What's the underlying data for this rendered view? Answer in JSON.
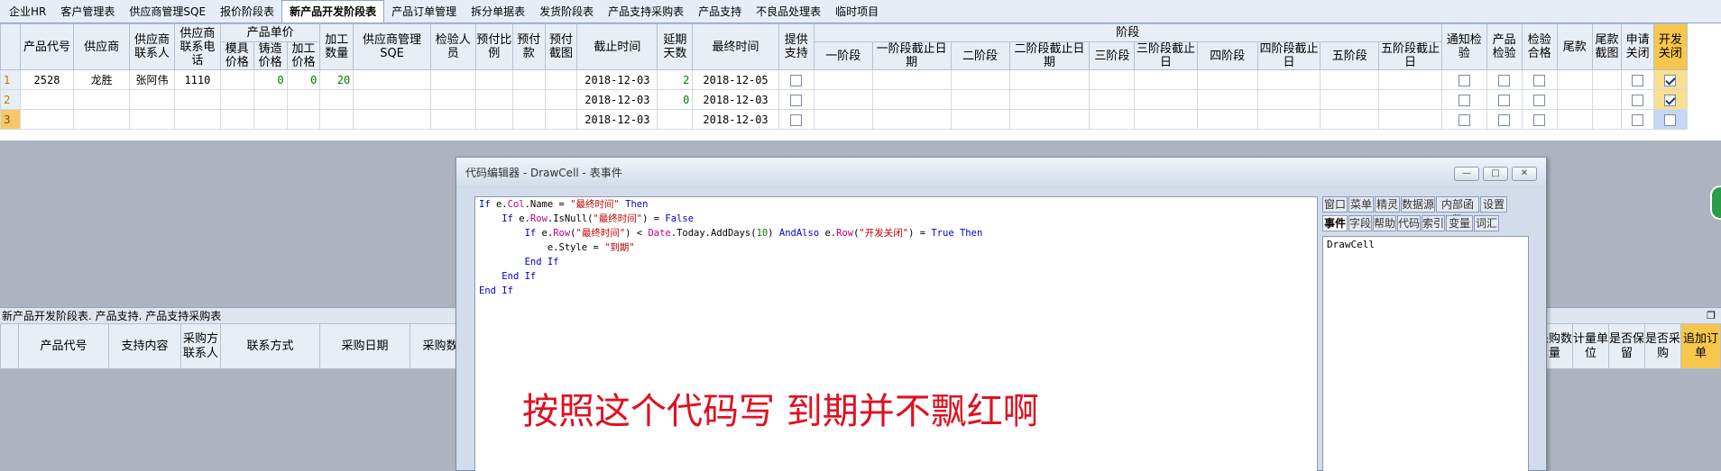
{
  "tabs": [
    "企业HR",
    "客户管理表",
    "供应商管理SQE",
    "报价阶段表",
    "新产品开发阶段表",
    "产品订单管理",
    "拆分单据表",
    "发货阶段表",
    "产品支持采购表",
    "产品支持",
    "不良品处理表",
    "临时项目"
  ],
  "active_tab_index": 4,
  "grid": {
    "group_price": "产品单价",
    "group_stage": "阶段",
    "headers_a": [
      "产品代号",
      "供应商",
      "供应商联系人",
      "供应商联系电话"
    ],
    "headers_price": [
      "模具价格",
      "铸造价格",
      "加工价格"
    ],
    "headers_b": [
      "加工数量",
      "供应商管理SQE",
      "检验人员",
      "预付比例",
      "预付款",
      "预付截图",
      "截止时间",
      "延期天数",
      "最终时间",
      "提供支持"
    ],
    "headers_stage": [
      "一阶段",
      "一阶段截止日期",
      "二阶段",
      "二阶段截止日期",
      "三阶段",
      "三阶段截止日",
      "四阶段",
      "四阶段截止日",
      "五阶段",
      "五阶段截止日"
    ],
    "headers_c": [
      "通知检验",
      "产品检验",
      "检验合格",
      "尾款",
      "尾款截图",
      "申请关闭",
      "开发关闭"
    ],
    "rows": [
      {
        "rn": "1",
        "code": "2528",
        "supplier": "龙胜",
        "contact": "张阿伟",
        "phone": "1110",
        "mold": "",
        "cast": "0",
        "proc": "0",
        "qty": "20",
        "deadline": "2018-12-03",
        "delay": "2",
        "final": "2018-12-05",
        "checks": [
          false,
          false,
          false,
          false,
          false,
          true
        ]
      },
      {
        "rn": "2",
        "code": "",
        "supplier": "",
        "contact": "",
        "phone": "",
        "mold": "",
        "cast": "",
        "proc": "",
        "qty": "",
        "deadline": "2018-12-03",
        "delay": "0",
        "final": "2018-12-03",
        "checks": [
          false,
          false,
          false,
          false,
          false,
          true
        ]
      },
      {
        "rn": "3",
        "code": "",
        "supplier": "",
        "contact": "",
        "phone": "",
        "mold": "",
        "cast": "",
        "proc": "",
        "qty": "",
        "deadline": "2018-12-03",
        "delay": "",
        "final": "2018-12-03",
        "checks": [
          false,
          false,
          false,
          false,
          false,
          false
        ]
      }
    ]
  },
  "panel2": {
    "title": "新产品开发阶段表. 产品支持. 产品支持采购表",
    "pin": "❐",
    "left_headers": [
      "产品代号",
      "支持内容",
      "采购方联系人",
      "联系方式",
      "采购日期",
      "采购数量"
    ],
    "right_headers": [
      "采购数量",
      "计量单位",
      "是否保留",
      "是否采购",
      "追加订单"
    ]
  },
  "dialog": {
    "title": "代码编辑器 - DrawCell - 表事件",
    "buttons": [
      "—",
      "□",
      "✕"
    ],
    "note": "按照这个代码写 到期并不飘红啊",
    "tabs_row1": [
      "窗口",
      "菜单",
      "精灵",
      "数据源",
      "内部函数",
      "设置"
    ],
    "tabs_row2": [
      "事件",
      "字段",
      "帮助",
      "代码",
      "索引",
      "变量",
      "词汇"
    ],
    "event": "DrawCell",
    "code": [
      [
        [
          "kw",
          "If "
        ],
        [
          "t",
          "e."
        ],
        [
          "prop",
          "Col"
        ],
        [
          "t",
          ".Name = "
        ],
        [
          "str",
          "\"最终时间\""
        ],
        [
          "kw",
          " Then"
        ]
      ],
      [
        [
          "t",
          "    "
        ],
        [
          "kw",
          "If "
        ],
        [
          "t",
          "e."
        ],
        [
          "prop",
          "Row"
        ],
        [
          "t",
          ".IsNull("
        ],
        [
          "str",
          "\"最终时间\""
        ],
        [
          "t",
          ") = "
        ],
        [
          "kw",
          "False"
        ]
      ],
      [
        [
          "t",
          "        "
        ],
        [
          "kw",
          "If "
        ],
        [
          "t",
          "e."
        ],
        [
          "prop",
          "Row"
        ],
        [
          "t",
          "("
        ],
        [
          "str",
          "\"最终时间\""
        ],
        [
          "t",
          ") < "
        ],
        [
          "prop",
          "Date"
        ],
        [
          "t",
          ".Today.AddDays("
        ],
        [
          "num",
          "10"
        ],
        [
          "t",
          ") "
        ],
        [
          "kw",
          "AndAlso "
        ],
        [
          "t",
          "e."
        ],
        [
          "prop",
          "Row"
        ],
        [
          "t",
          "("
        ],
        [
          "str",
          "\"开发关闭\""
        ],
        [
          "t",
          ") = "
        ],
        [
          "kw",
          "True Then"
        ]
      ],
      [
        [
          "t",
          "            e.Style = "
        ],
        [
          "str",
          "\"到期\""
        ]
      ],
      [
        [
          "t",
          "        "
        ],
        [
          "kw",
          "End If"
        ]
      ],
      [
        [
          "t",
          "    "
        ],
        [
          "kw",
          "End If"
        ]
      ],
      [
        [
          "kw",
          "End If"
        ]
      ]
    ]
  }
}
